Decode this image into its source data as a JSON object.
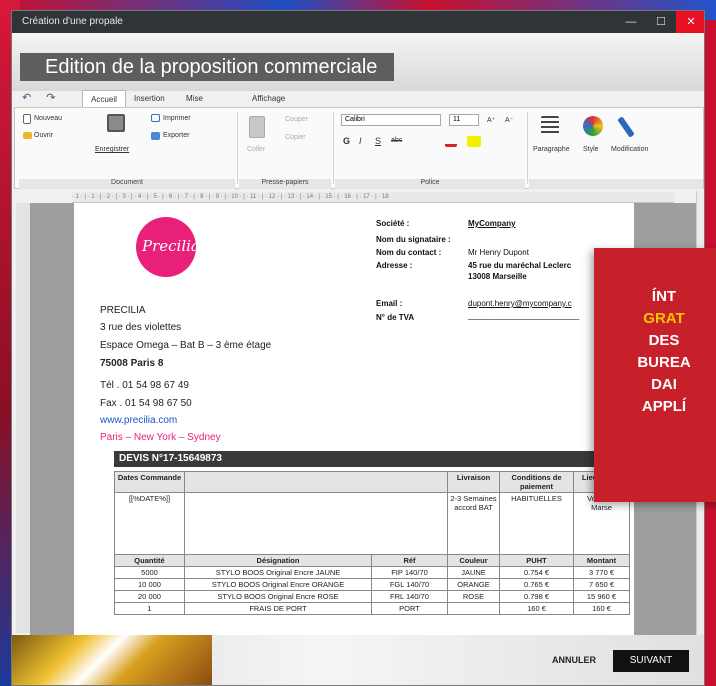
{
  "window": {
    "title": "Création d'une propale",
    "minimize": "—",
    "maximize": "☐",
    "close": "✕"
  },
  "header": {
    "title": "Edition de la proposition commerciale"
  },
  "quick_access": {
    "undo": "↶",
    "redo": "↷"
  },
  "tabs": [
    "Accueil",
    "Insertion",
    "Mise en page",
    "Affichage"
  ],
  "ribbon": {
    "document": {
      "label": "Document",
      "new": "Nouveau",
      "open": "Ouvrir",
      "save": "Enregistrer",
      "print": "Imprimer",
      "export": "Exporter"
    },
    "clipboard": {
      "label": "Presse-papiers",
      "paste": "Coller",
      "cut": "Couper",
      "copy": "Copier"
    },
    "font": {
      "label": "Police",
      "name": "Calibri",
      "size": "11",
      "bold": "G",
      "italic": "I",
      "underline": "S",
      "strike": "abc",
      "grow": "A⁺",
      "shrink": "A⁻"
    },
    "paragraph": "Paragraphe",
    "style": "Style",
    "edit": "Modification"
  },
  "ruler": "· 1 · | · 1 · | · 2 · | · 3 · | · 4 · | · 5 · | · 6 · | · 7 · | · 8 · | · 9 · | · 10 · | · 11 · | · 12 · | · 13 · | · 14 · | · 15 · | · 16 · | · 17 · | · 18",
  "document": {
    "logo_text": "Precilia",
    "company_block": {
      "name": "PRECILIA",
      "line1": "3 rue des violettes",
      "line2": "Espace Omega – Bat B – 3 ème étage",
      "line3": "75008 Paris 8",
      "tel": "Tél . 01 54 98 67 49",
      "fax": "Fax . 01 54 98 67 50",
      "web": "www.precilia.com",
      "cities": "Paris – New York – Sydney"
    },
    "client": {
      "societe_label": "Société :",
      "societe": "MyCompany",
      "signataire_label": "Nom du signataire :",
      "contact_label": "Nom du contact :",
      "contact": "Mr Henry Dupont",
      "adresse_label": "Adresse :",
      "adresse1": "45 rue du maréchal Leclerc",
      "adresse2": "13008 Marseille",
      "email_label": "Email :",
      "email": "dupont.henry@mycompany.c",
      "tva_label": "N° de TVA",
      "tva": "_________________________"
    },
    "devis_title": "DEVIS N°17-15649873",
    "table1": {
      "headers": [
        "Dates Commande",
        "",
        "Livraison",
        "Conditions de paiement",
        "Lieu livrais"
      ],
      "row": [
        "[[%DATE%]]",
        "",
        "2-3 Semaines accord BAT",
        "HABITUELLES",
        "Vo locau Marse"
      ]
    },
    "table2": {
      "headers": [
        "Quantité",
        "Désignation",
        "Réf",
        "Couleur",
        "PUHT",
        "Montant"
      ],
      "rows": [
        [
          "5000",
          "STYLO BOOS Original Encre JAUNE",
          "FIP 140/70",
          "JAUNE",
          "0.754 €",
          "3 770 €"
        ],
        [
          "10 000",
          "STYLO BOOS Original Encre ORANGE",
          "FGL 140/70",
          "ORANGE",
          "0.765 €",
          "7 650 €"
        ],
        [
          "20 000",
          "STYLO BOOS Original Encre ROSE",
          "FRL 140/70",
          "ROSE",
          "0.798 €",
          "15 960 €"
        ],
        [
          "1",
          "FRAIS DE PORT",
          "PORT",
          "",
          "160 €",
          "160 €"
        ]
      ]
    }
  },
  "footer": {
    "cancel": "ANNULER",
    "next": "SUIVANT"
  },
  "promo": {
    "line1": "ÍNT",
    "line2": "GRAT",
    "line3": "DES",
    "line4": "BUREA",
    "line5": "DAI",
    "line6": "APPLÍ"
  },
  "colors": {
    "accent": "#c8202a",
    "logo": "#e8207a",
    "link": "#1a56c8",
    "close": "#e81123"
  }
}
